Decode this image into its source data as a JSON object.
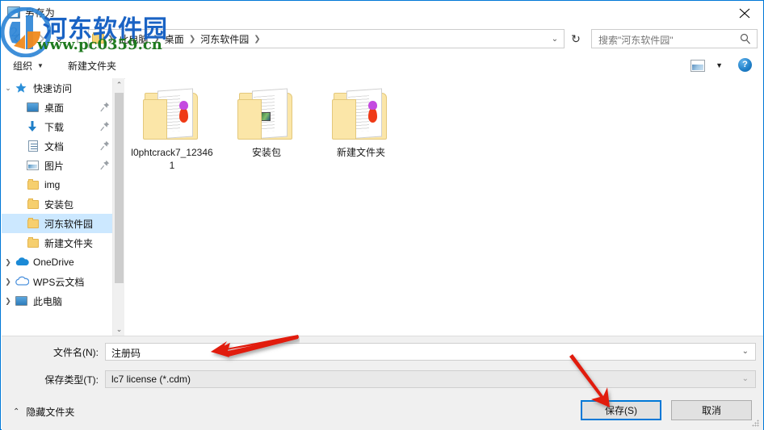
{
  "window": {
    "title": "另存为",
    "close_label": "✕"
  },
  "nav": {
    "back_icon": "back-arrow-icon",
    "forward_icon": "forward-arrow-icon",
    "recent_icon": "recent-locations-icon",
    "up_icon": "up-arrow-icon",
    "up_glyph": "↑",
    "recent_glyph": "⌄",
    "refresh_glyph": "↻",
    "address_dropdown_glyph": "⌄"
  },
  "breadcrumb": {
    "items": [
      {
        "label": "此电脑"
      },
      {
        "label": "桌面"
      },
      {
        "label": "河东软件园"
      }
    ],
    "separator": "❯"
  },
  "search": {
    "placeholder": "搜索\"河东软件园\"",
    "icon": "search-icon"
  },
  "toolbar": {
    "organize_label": "组织",
    "organize_caret": "▼",
    "new_folder_label": "新建文件夹",
    "view_icon": "view-mode-icon",
    "view_caret": "▼",
    "help_label": "?"
  },
  "sidebar": {
    "items": [
      {
        "label": "快速访问",
        "icon": "star-icon",
        "chevron": "⌄",
        "pinned": false,
        "selected": false,
        "indent": 0
      },
      {
        "label": "桌面",
        "icon": "desktop-icon",
        "chevron": "",
        "pinned": true,
        "selected": false,
        "indent": 1
      },
      {
        "label": "下载",
        "icon": "download-icon",
        "chevron": "",
        "pinned": true,
        "selected": false,
        "indent": 1
      },
      {
        "label": "文档",
        "icon": "documents-icon",
        "chevron": "",
        "pinned": true,
        "selected": false,
        "indent": 1
      },
      {
        "label": "图片",
        "icon": "pictures-icon",
        "chevron": "",
        "pinned": true,
        "selected": false,
        "indent": 1
      },
      {
        "label": "img",
        "icon": "folder-icon",
        "chevron": "",
        "pinned": false,
        "selected": false,
        "indent": 1
      },
      {
        "label": "安装包",
        "icon": "folder-icon",
        "chevron": "",
        "pinned": false,
        "selected": false,
        "indent": 1
      },
      {
        "label": "河东软件园",
        "icon": "folder-icon",
        "chevron": "",
        "pinned": false,
        "selected": true,
        "indent": 1
      },
      {
        "label": "新建文件夹",
        "icon": "folder-icon",
        "chevron": "",
        "pinned": false,
        "selected": false,
        "indent": 1
      },
      {
        "label": "OneDrive",
        "icon": "onedrive-cloud-icon",
        "chevron": "❯",
        "pinned": false,
        "selected": false,
        "indent": 0
      },
      {
        "label": "WPS云文档",
        "icon": "wps-cloud-icon",
        "chevron": "❯",
        "pinned": false,
        "selected": false,
        "indent": 0
      },
      {
        "label": "此电脑",
        "icon": "this-pc-icon",
        "chevron": "❯",
        "pinned": false,
        "selected": false,
        "indent": 0
      }
    ],
    "scroll_up_glyph": "⌃",
    "scroll_down_glyph": "⌄"
  },
  "files": [
    {
      "name": "l0phtcrack7_123461",
      "badge": "flame"
    },
    {
      "name": "安装包",
      "badge": "image"
    },
    {
      "name": "新建文件夹",
      "badge": "flame"
    }
  ],
  "form": {
    "filename_label": "文件名(N):",
    "filename_value": "注册码",
    "filetype_label": "保存类型(T):",
    "filetype_value": "lc7 license (*.cdm)",
    "dropdown_glyph": "⌄"
  },
  "footer": {
    "hide_folders_label": "隐藏文件夹",
    "hide_folders_chevron": "⌃",
    "save_label": "保存(S)",
    "cancel_label": "取消"
  },
  "watermark": {
    "text": "河东软件园",
    "url": "www.pc0359.cn",
    "text_color": "#1a63c4",
    "url_color": "#1f7a1f"
  },
  "colors": {
    "accent": "#0078d7",
    "selection": "#cce8ff",
    "chrome": "#f0f0f0",
    "annotation": "#e11b11"
  }
}
